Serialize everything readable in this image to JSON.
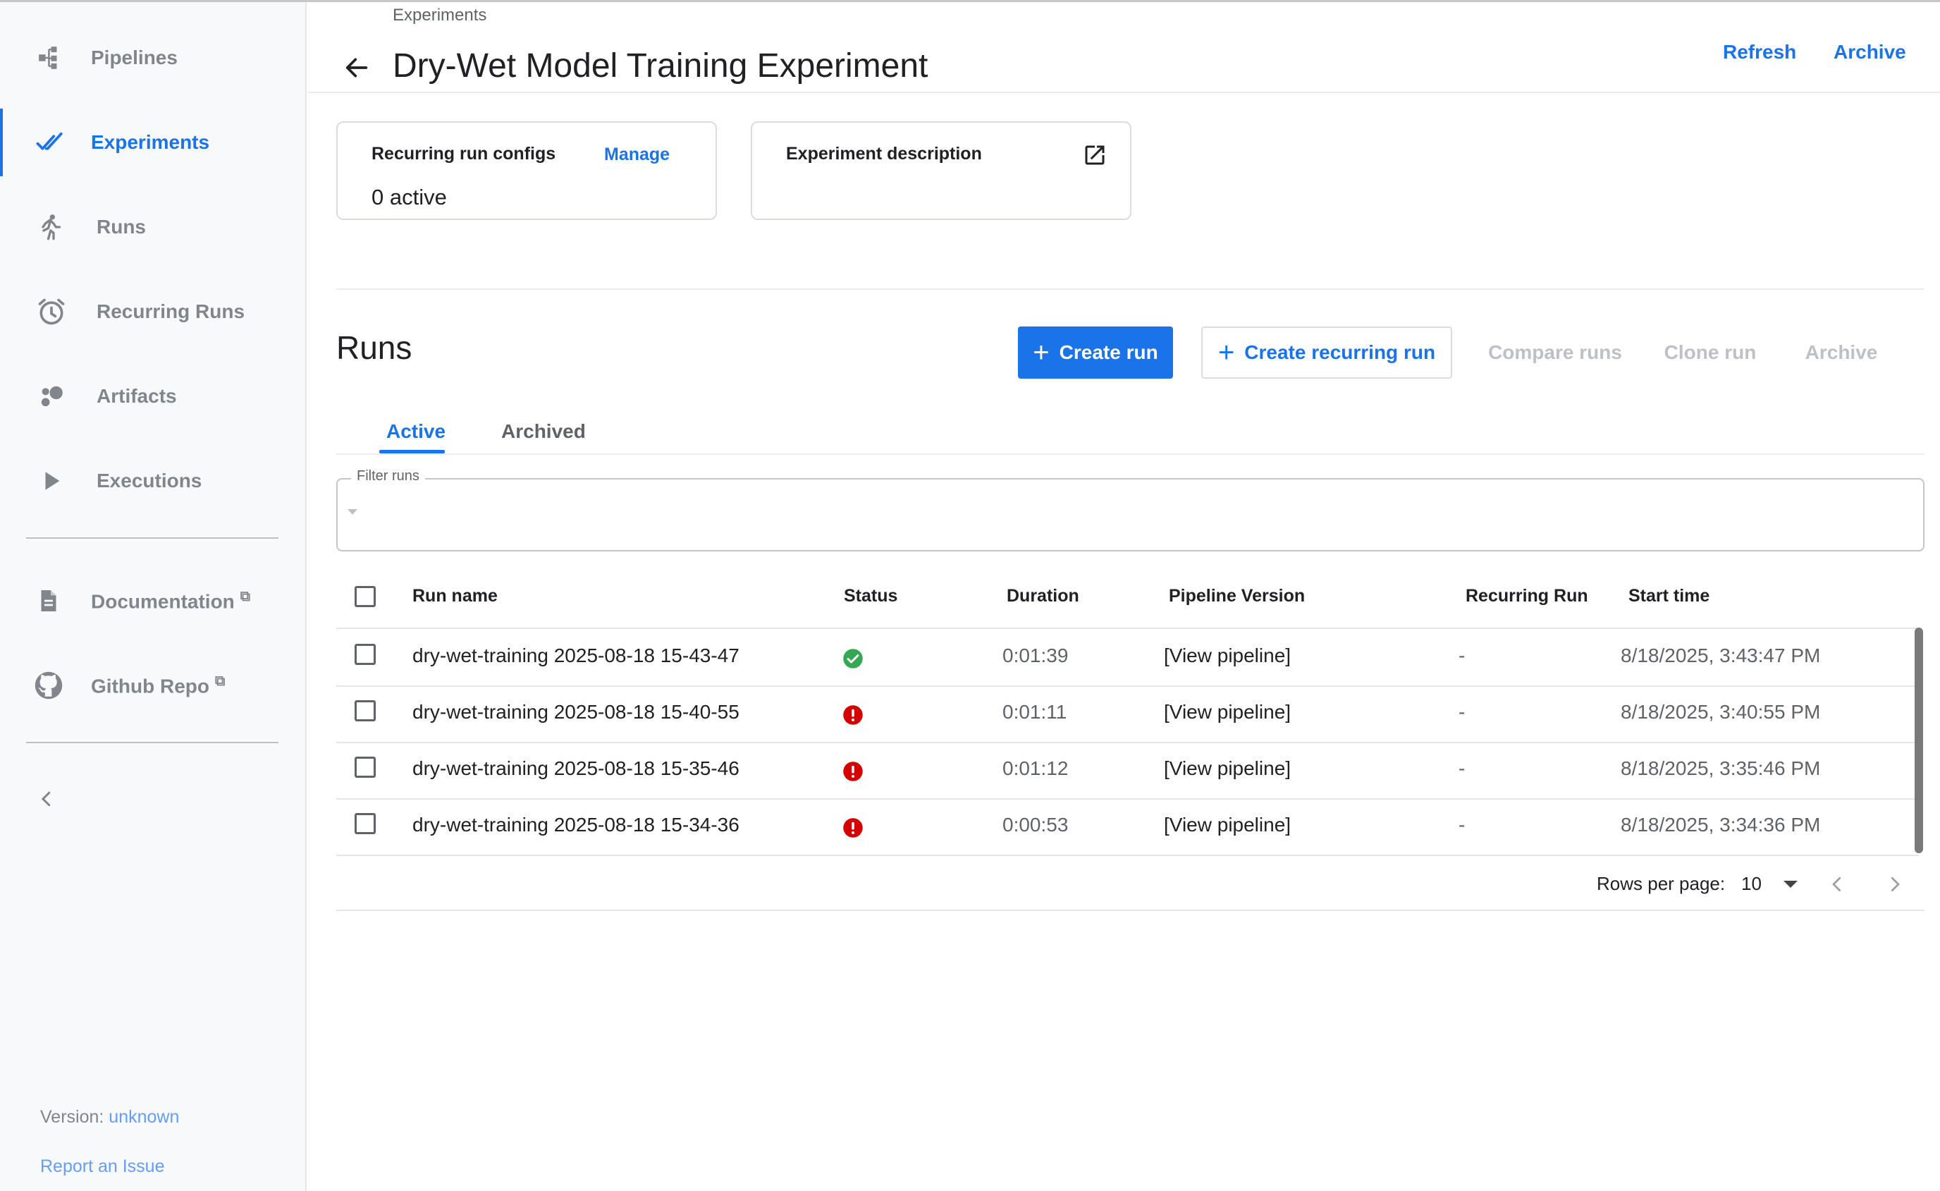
{
  "sidebar": {
    "items": [
      {
        "label": "Pipelines",
        "icon": "pipelines-icon",
        "active": false
      },
      {
        "label": "Experiments",
        "icon": "experiments-icon",
        "active": true
      },
      {
        "label": "Runs",
        "icon": "runs-icon",
        "active": false
      },
      {
        "label": "Recurring Runs",
        "icon": "alarm-icon",
        "active": false
      },
      {
        "label": "Artifacts",
        "icon": "artifacts-icon",
        "active": false
      },
      {
        "label": "Executions",
        "icon": "play-icon",
        "active": false
      }
    ],
    "links": [
      {
        "label": "Documentation",
        "icon": "document-icon"
      },
      {
        "label": "Github Repo",
        "icon": "github-icon"
      }
    ],
    "version_label": "Version:",
    "version_value": "unknown",
    "report_label": "Report an Issue"
  },
  "header": {
    "breadcrumb": "Experiments",
    "title": "Dry-Wet Model Training Experiment",
    "refresh_label": "Refresh",
    "archive_label": "Archive"
  },
  "cards": {
    "recurring": {
      "title": "Recurring run configs",
      "manage_label": "Manage",
      "value": "0 active"
    },
    "description": {
      "title": "Experiment description"
    }
  },
  "runs": {
    "title": "Runs",
    "toolbar": {
      "create_run": "Create run",
      "create_recurring": "Create recurring run",
      "compare": "Compare runs",
      "clone": "Clone run",
      "archive": "Archive"
    },
    "tabs": {
      "active": "Active",
      "archived": "Archived"
    },
    "filter": {
      "label": "Filter runs",
      "value": ""
    },
    "columns": {
      "name": "Run name",
      "status": "Status",
      "duration": "Duration",
      "pipeline_version": "Pipeline Version",
      "recurring_run": "Recurring Run",
      "start_time": "Start time"
    },
    "rows": [
      {
        "name": "dry-wet-training 2025-08-18 15-43-47",
        "status": "succeeded",
        "duration": "0:01:39",
        "pipeline": "[View pipeline]",
        "recurring": "-",
        "start": "8/18/2025, 3:43:47 PM"
      },
      {
        "name": "dry-wet-training 2025-08-18 15-40-55",
        "status": "failed",
        "duration": "0:01:11",
        "pipeline": "[View pipeline]",
        "recurring": "-",
        "start": "8/18/2025, 3:40:55 PM"
      },
      {
        "name": "dry-wet-training 2025-08-18 15-35-46",
        "status": "failed",
        "duration": "0:01:12",
        "pipeline": "[View pipeline]",
        "recurring": "-",
        "start": "8/18/2025, 3:35:46 PM"
      },
      {
        "name": "dry-wet-training 2025-08-18 15-34-36",
        "status": "failed",
        "duration": "0:00:53",
        "pipeline": "[View pipeline]",
        "recurring": "-",
        "start": "8/18/2025, 3:34:36 PM"
      }
    ],
    "pagination": {
      "rows_per_page_label": "Rows per page:",
      "rows_per_page": "10"
    }
  },
  "colors": {
    "accent": "#1a73e8",
    "success": "#34a853",
    "error": "#d50000",
    "muted": "#80868b"
  }
}
